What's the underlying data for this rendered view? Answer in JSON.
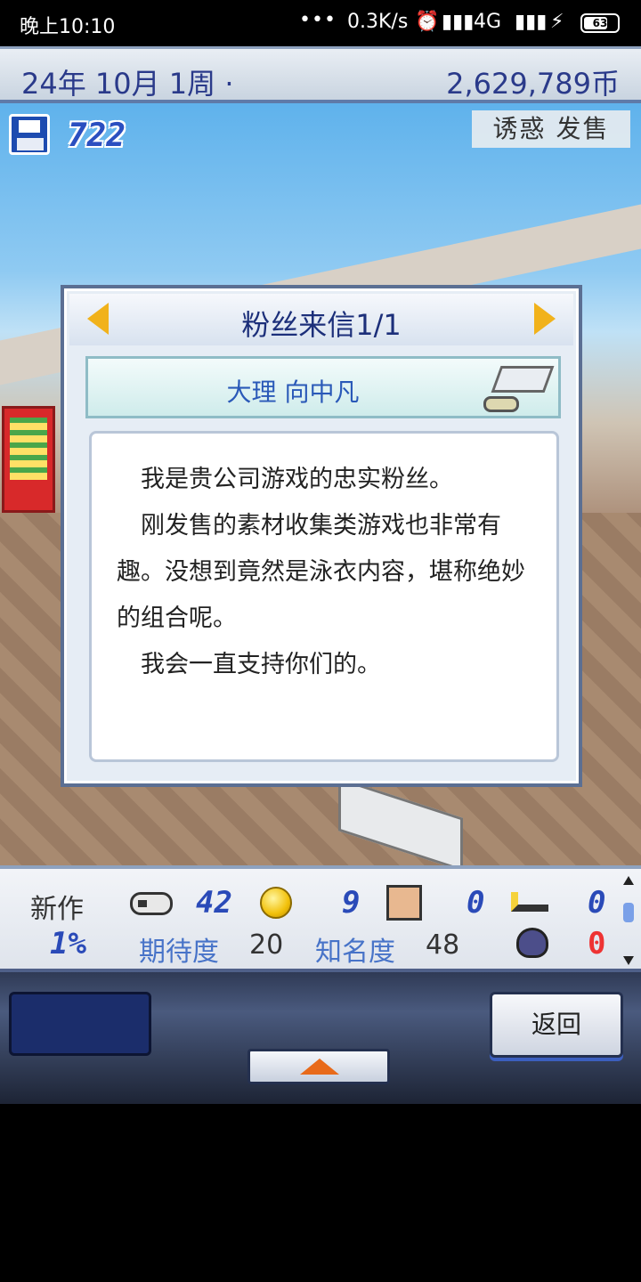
{
  "status_bar": {
    "time": "晚上10:10",
    "dots": "•••",
    "speed": "0.3K/s",
    "alarm_icon": "alarm-icon",
    "network": "4G",
    "battery": "63"
  },
  "header": {
    "date": "24年 10月 1周 ·",
    "money": "2,629,789币"
  },
  "scene": {
    "points": "722",
    "promo_label": "诱惑 发售"
  },
  "dialog": {
    "title": "粉丝来信1/1",
    "sender": "大理 向中凡",
    "letter_lines": [
      "　我是贵公司游戏的忠实粉丝。",
      "　刚发售的素材收集类游戏也非常有趣。没想到竟然是泳衣内容，堪称绝妙的组合呢。",
      "　我会一直支持你们的。"
    ]
  },
  "stats": {
    "new_label": "新作",
    "games_count": "42",
    "coins_count": "9",
    "award_count": "0",
    "key_count": "0",
    "percent": "1%",
    "expect_label": "期待度",
    "expect_value": "20",
    "fame_label": "知名度",
    "fame_value": "48",
    "monster_count": "0"
  },
  "controls": {
    "back_label": "返回"
  },
  "colors": {
    "accent": "#2a3a8a",
    "arrow": "#f1b21b",
    "danger": "#e33333"
  }
}
